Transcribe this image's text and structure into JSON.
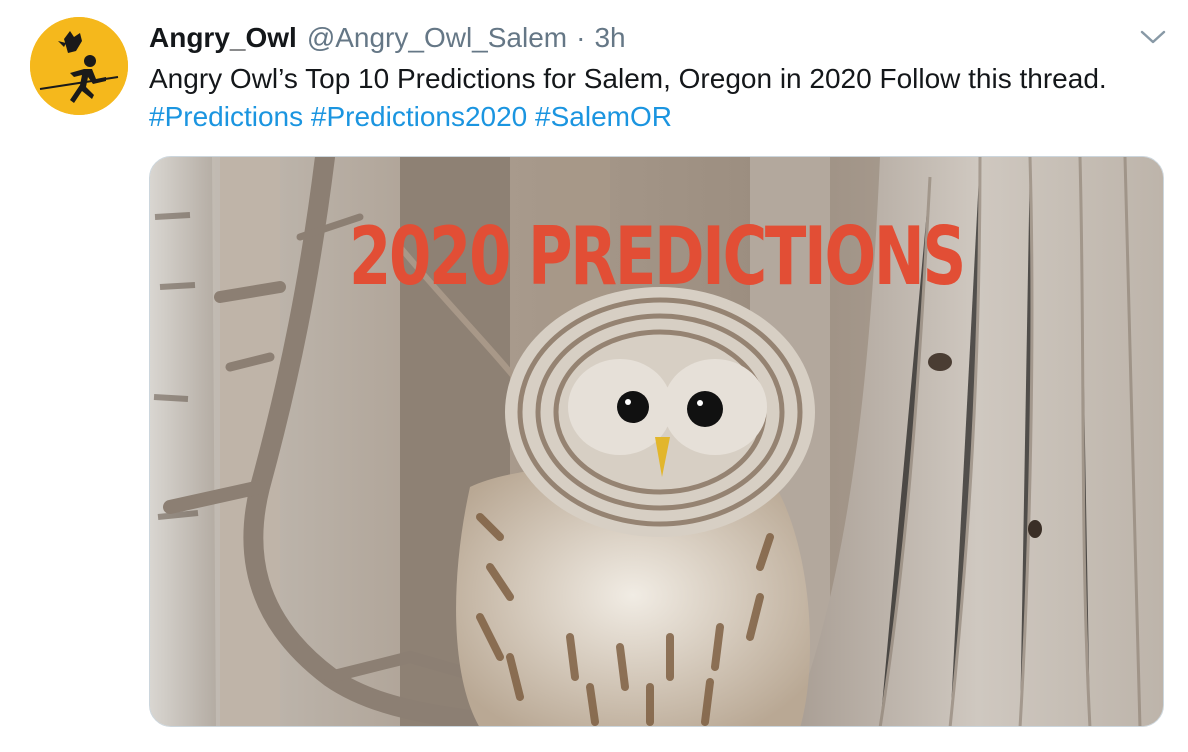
{
  "tweet": {
    "author_name": "Angry_Owl",
    "author_handle": "@Angry_Owl_Salem",
    "separator": "·",
    "time": "3h",
    "text_main": "Angry Owl’s Top 10 Predictions for Salem, Oregon in 2020 Follow this thread.",
    "hashtags": [
      "#Predictions",
      "#Predictions2020",
      "#SalemOR"
    ],
    "image_overlay_text": "2020 PREDICTIONS"
  },
  "colors": {
    "link": "#1b95e0",
    "secondary_text": "#657786",
    "avatar_bg": "#f5b81c",
    "overlay_text": "#e24e35"
  },
  "icons": {
    "menu": "chevron-down-icon",
    "avatar": "owl-running-man-logo"
  }
}
